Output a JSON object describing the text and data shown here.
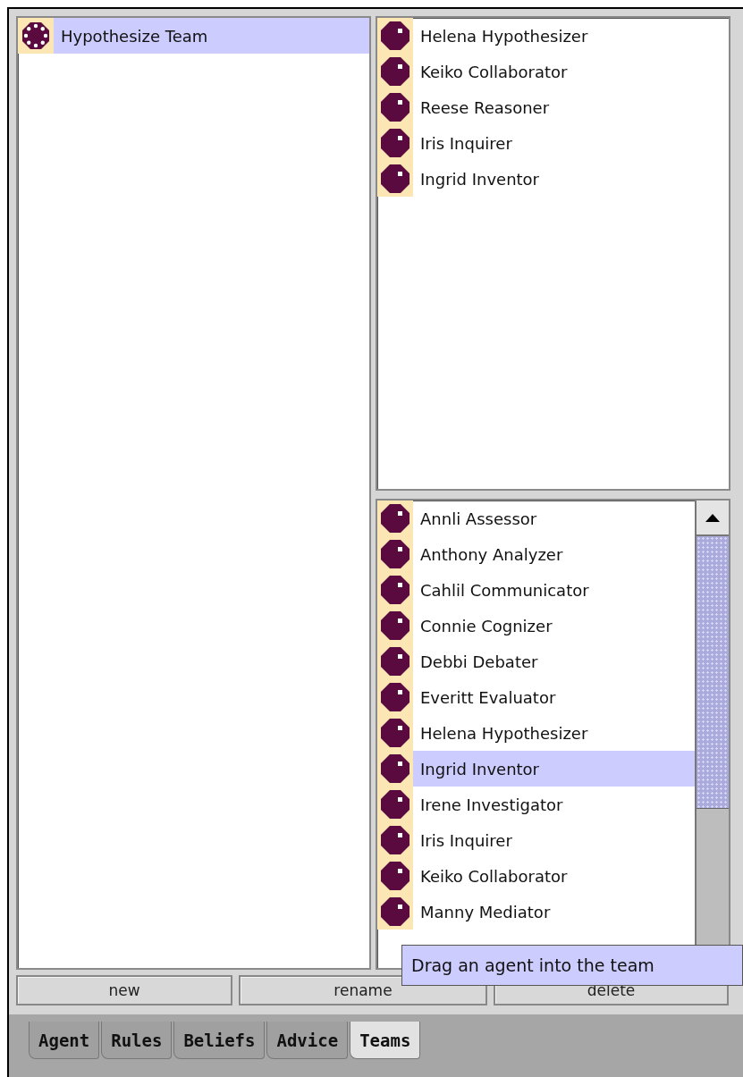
{
  "teams": {
    "items": [
      {
        "label": "Hypothesize Team",
        "selected": true
      }
    ]
  },
  "team_members": {
    "items": [
      {
        "label": "Helena Hypothesizer",
        "selected": false
      },
      {
        "label": "Keiko Collaborator",
        "selected": false
      },
      {
        "label": "Reese Reasoner",
        "selected": false
      },
      {
        "label": "Iris Inquirer",
        "selected": false
      },
      {
        "label": "Ingrid Inventor",
        "selected": false
      }
    ]
  },
  "agents": {
    "items": [
      {
        "label": "Annli Assessor",
        "selected": false
      },
      {
        "label": "Anthony Analyzer",
        "selected": false
      },
      {
        "label": "Cahlil Communicator",
        "selected": false
      },
      {
        "label": "Connie Cognizer",
        "selected": false
      },
      {
        "label": "Debbi Debater",
        "selected": false
      },
      {
        "label": "Everitt Evaluator",
        "selected": false
      },
      {
        "label": "Helena Hypothesizer",
        "selected": false
      },
      {
        "label": "Ingrid Inventor",
        "selected": true
      },
      {
        "label": "Irene Investigator",
        "selected": false
      },
      {
        "label": "Iris Inquirer",
        "selected": false
      },
      {
        "label": "Keiko Collaborator",
        "selected": false
      },
      {
        "label": "Manny Mediator",
        "selected": false
      }
    ]
  },
  "tooltip": "Drag an agent into the team",
  "buttons": [
    "new",
    "rename",
    "delete"
  ],
  "tabs": [
    {
      "label": "Agent",
      "selected": false
    },
    {
      "label": "Rules",
      "selected": false
    },
    {
      "label": "Beliefs",
      "selected": false
    },
    {
      "label": "Advice",
      "selected": false
    },
    {
      "label": "Teams",
      "selected": true
    }
  ]
}
